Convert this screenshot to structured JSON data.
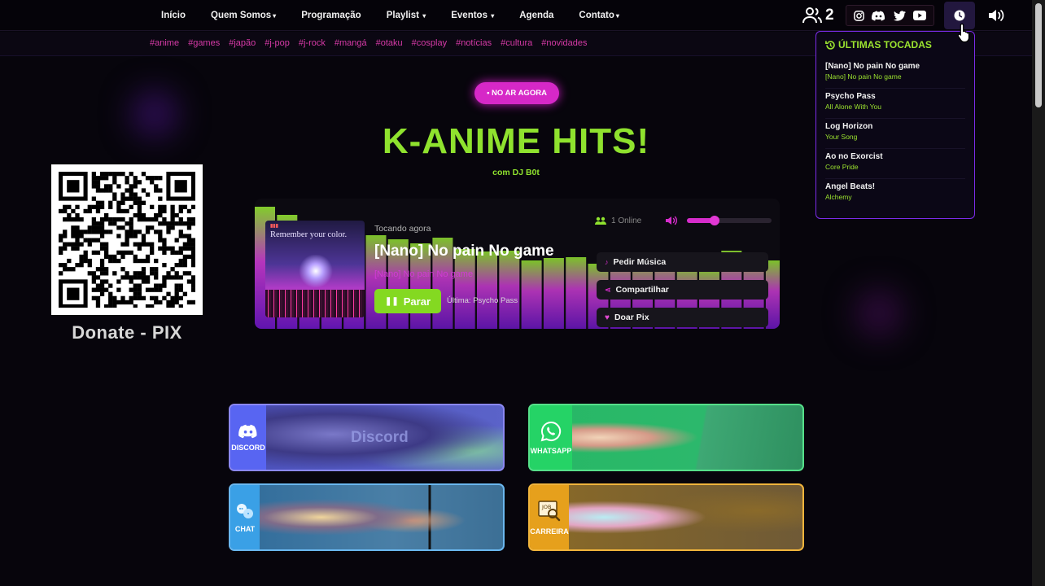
{
  "nav": {
    "items": [
      {
        "label": "Início",
        "dropdown": false
      },
      {
        "label": "Quem Somos",
        "dropdown": true
      },
      {
        "label": "Programação",
        "dropdown": false
      },
      {
        "label": "Playlist",
        "dropdown": true
      },
      {
        "label": "Eventos",
        "dropdown": true
      },
      {
        "label": "Agenda",
        "dropdown": false
      },
      {
        "label": "Contato",
        "dropdown": true
      }
    ],
    "users_count": "2",
    "social_icons": [
      "instagram-icon",
      "discord-icon",
      "twitter-icon",
      "youtube-icon"
    ]
  },
  "tags": [
    "#anime",
    "#games",
    "#japão",
    "#j-pop",
    "#j-rock",
    "#mangá",
    "#otaku",
    "#cosplay",
    "#notícias",
    "#cultura",
    "#novidades"
  ],
  "history": {
    "title": "ÚLTIMAS TOCADAS",
    "items": [
      {
        "song": "[Nano] No pain No game",
        "artist": "[Nano] No pain No game"
      },
      {
        "song": "Psycho Pass",
        "artist": "All Alone With You"
      },
      {
        "song": "Log Horizon",
        "artist": "Your Song"
      },
      {
        "song": "Ao no Exorcist",
        "artist": "Core Pride"
      },
      {
        "song": "Angel Beats!",
        "artist": "Alchemy"
      }
    ]
  },
  "live_badge": "• NO AR AGORA",
  "show": {
    "title": "K-ANIME HITS!",
    "dj": "com DJ B0t"
  },
  "donate": {
    "label": "Donate - PIX"
  },
  "player": {
    "now_label": "Tocando agora",
    "song_title": "[Nano] No pain No game",
    "song_subtitle": "[Nano] No pain No game",
    "cover_text": "Remember your color.",
    "stop_label": "Parar",
    "last_label": "Última: Psycho Pass",
    "online": "1 Online",
    "volume": 0.33,
    "actions": [
      "Pedir Música",
      "Compartilhar",
      "Doar Pix"
    ]
  },
  "cards": [
    {
      "label": "DISCORD",
      "word": "Discord",
      "color": "#5865f2"
    },
    {
      "label": "WHATSAPP",
      "word": "",
      "color": "#25d366"
    },
    {
      "label": "CHAT",
      "word": "",
      "color": "#3aa0e6"
    },
    {
      "label": "CARREIRA",
      "word": "",
      "color": "#e6a01c"
    }
  ],
  "colors": {
    "accent_green": "#8fe22e",
    "accent_pink": "#d628c7",
    "accent_purple": "#7b2be8"
  }
}
